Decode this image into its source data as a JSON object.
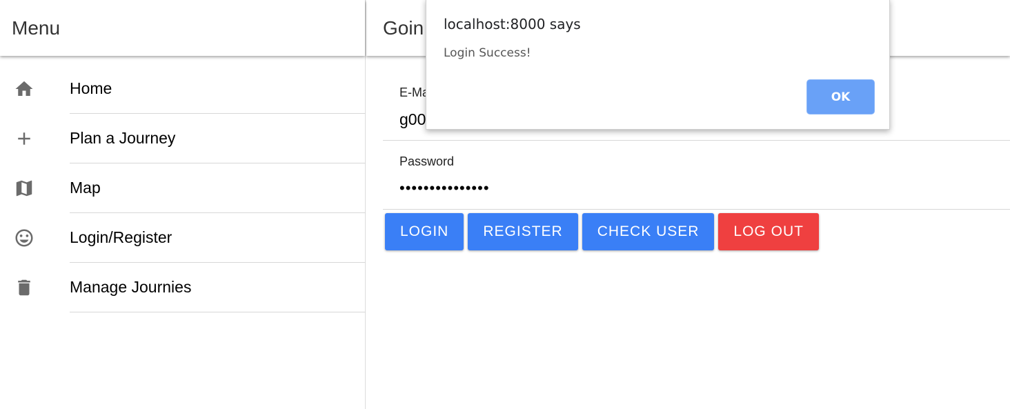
{
  "sidebar": {
    "title": "Menu",
    "items": [
      {
        "label": "Home",
        "icon": "home-icon"
      },
      {
        "label": "Plan a Journey",
        "icon": "plus-icon"
      },
      {
        "label": "Map",
        "icon": "map-icon"
      },
      {
        "label": "Login/Register",
        "icon": "smiley-icon"
      },
      {
        "label": "Manage Journies",
        "icon": "trash-icon"
      }
    ]
  },
  "main": {
    "title": "Goin"
  },
  "form": {
    "email": {
      "label": "E-Mail",
      "value": "g00"
    },
    "password": {
      "label": "Password",
      "value": "•••••••••••••••"
    }
  },
  "buttons": {
    "login": "LOGIN",
    "register": "REGISTER",
    "check_user": "CHECK USER",
    "logout": "LOG OUT"
  },
  "dialog": {
    "origin": "localhost:8000 says",
    "message": "Login Success!",
    "ok": "OK"
  },
  "colors": {
    "primary": "#3a7ff6",
    "danger": "#ef4040",
    "dialog_ok": "#69a1f7",
    "icon": "#6b6b6b"
  }
}
